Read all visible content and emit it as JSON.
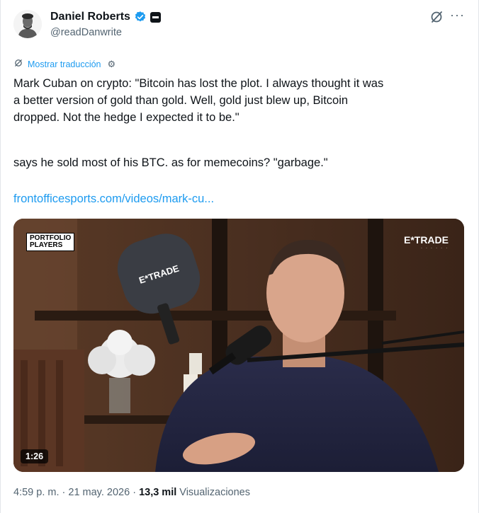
{
  "author": {
    "name": "Daniel Roberts",
    "handle": "@readDanwrite"
  },
  "translate": {
    "label": "Mostrar traducción"
  },
  "tweet": {
    "line1": "Mark Cuban on crypto: \"Bitcoin has lost the plot. I always thought it was",
    "line2": "a better version of gold than gold. Well, gold just blew up, Bitcoin",
    "line3": "dropped. Not the hedge I expected it to be.\"",
    "paragraph2": "says he sold most of his BTC. as for memecoins? \"garbage.\"",
    "link": "frontofficesports.com/videos/mark-cu..."
  },
  "media": {
    "duration": "1:26",
    "show_logo_line1": "PORTFOLIO",
    "show_logo_line2": "PLAYERS",
    "sponsor_logo": "E*TRADE",
    "paddle_logo": "E*TRADE"
  },
  "meta": {
    "time": "4:59 p. m.",
    "separator": " · ",
    "date": "21 may. 2026",
    "views_count": "13,3 mil",
    "views_label": "Visualizaciones"
  },
  "colors": {
    "accent": "#1d9bf0",
    "text": "#0f1419",
    "secondary": "#536471"
  }
}
